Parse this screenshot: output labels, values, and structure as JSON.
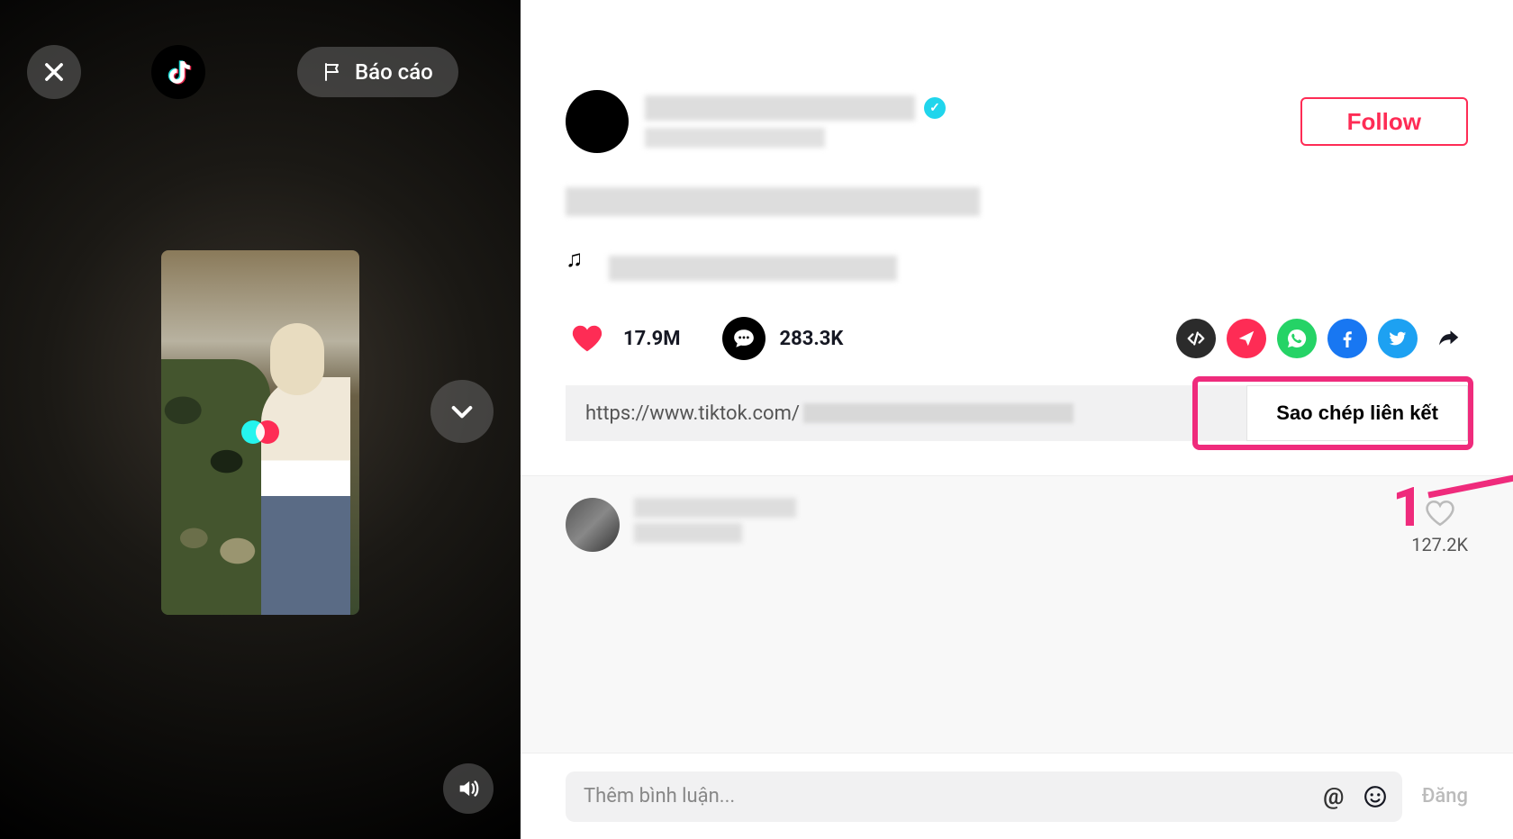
{
  "videoPane": {
    "reportLabel": "Báo cáo"
  },
  "profile": {
    "followLabel": "Follow"
  },
  "stats": {
    "likes": "17.9M",
    "comments": "283.3K"
  },
  "link": {
    "urlPrefix": "https://www.tiktok.com/",
    "copyLabel": "Sao chép liên kết"
  },
  "annotation": {
    "step": "1"
  },
  "topComment": {
    "likes": "127.2K"
  },
  "commentInput": {
    "placeholder": "Thêm bình luận...",
    "postLabel": "Đăng"
  },
  "shareIcons": {
    "embed": "embed",
    "send": "send",
    "whatsapp": "whatsapp",
    "facebook": "facebook",
    "twitter": "twitter",
    "forward": "forward"
  }
}
